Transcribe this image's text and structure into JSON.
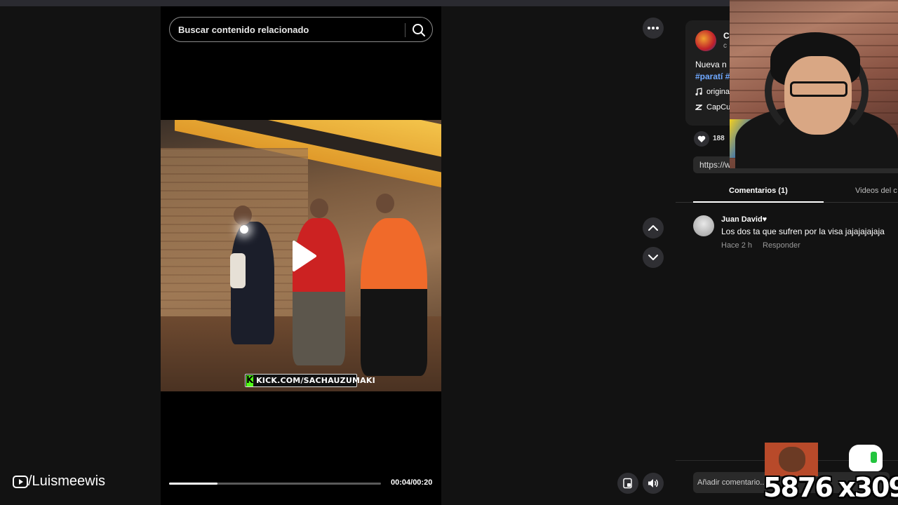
{
  "search": {
    "placeholder": "Buscar contenido relacionado"
  },
  "video": {
    "watermark_text": "KICK.COM/SACHAUZUMAKI",
    "kick_letter": "K",
    "progress": 0.23,
    "time": "00:04/00:20"
  },
  "channel": {
    "handle": "/Luismeewis"
  },
  "author": {
    "name": "C",
    "sub": "c",
    "description": "Nueva n",
    "hashtag": "#paratí #",
    "music": "origina",
    "capcut": "CapCu"
  },
  "stats": {
    "likes": "188"
  },
  "url": {
    "value": "https://ww"
  },
  "tabs": {
    "comments": "Comentarios (1)",
    "videos": "Videos del c"
  },
  "comments": [
    {
      "name": "Juan David♥",
      "text": "Los dos ta que sufren por la visa jajajajajaja",
      "time": "Hace 2 h",
      "reply": "Responder"
    }
  ],
  "add_comment": {
    "placeholder": "Añadir comentario..."
  },
  "overlay": {
    "counter_a": "5876",
    "counter_b": "x309"
  },
  "colors": {
    "accent_link": "#6fa8ff",
    "kick_green": "#53fc18",
    "background": "#121212"
  }
}
